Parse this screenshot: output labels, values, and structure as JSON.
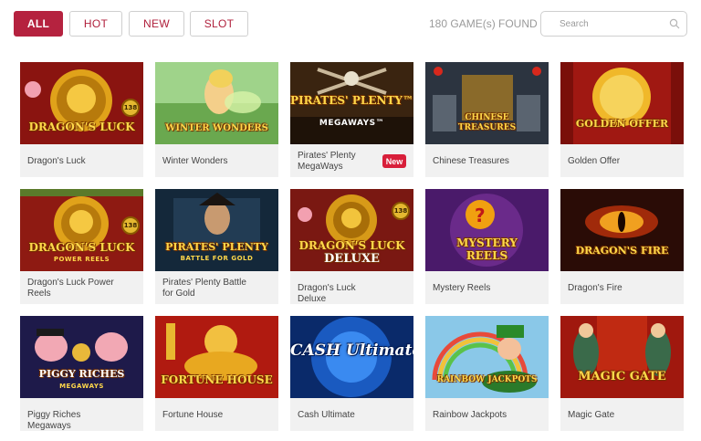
{
  "filters": {
    "all": "ALL",
    "hot": "HOT",
    "new": "NEW",
    "slot": "SLOT"
  },
  "games_found": "180 GAME(s) FOUND",
  "search": {
    "placeholder": "Search"
  },
  "colors": {
    "accent": "#b5223f",
    "badge": "#d81f3a"
  },
  "games": [
    {
      "name": "Dragon's Luck",
      "art_title": "DRAGON'S LUCK",
      "art_sub": "",
      "art_badge": "138",
      "new_label": ""
    },
    {
      "name": "Winter Wonders",
      "art_title": "WINTER WONDERS",
      "art_sub": "",
      "art_badge": "",
      "new_label": ""
    },
    {
      "name": "Pirates' Plenty MegaWays",
      "art_title": "PIRATES' PLENTY™",
      "art_sub": "MEGAWAYS™",
      "art_badge": "",
      "new_label": "New"
    },
    {
      "name": "Chinese Treasures",
      "art_title": "CHINESE TREASURES",
      "art_sub": "",
      "art_badge": "",
      "new_label": ""
    },
    {
      "name": "Golden Offer",
      "art_title": "GOLDEN OFFER",
      "art_sub": "",
      "art_badge": "",
      "new_label": ""
    },
    {
      "name": "Dragon's Luck Power Reels",
      "art_title": "DRAGON'S LUCK",
      "art_sub": "POWER REELS",
      "art_badge": "138",
      "new_label": ""
    },
    {
      "name": "Pirates' Plenty Battle for Gold",
      "art_title": "PIRATES' PLENTY",
      "art_sub": "BATTLE FOR GOLD",
      "art_badge": "",
      "new_label": ""
    },
    {
      "name": "Dragon's Luck Deluxe",
      "art_title": "DRAGON'S LUCK",
      "art_sub": "DELUXE",
      "art_badge": "138",
      "new_label": ""
    },
    {
      "name": "Mystery Reels",
      "art_title": "MYSTERY REELS",
      "art_sub": "",
      "art_badge": "",
      "new_label": ""
    },
    {
      "name": "Dragon's Fire",
      "art_title": "DRAGON'S FIRE",
      "art_sub": "",
      "art_badge": "",
      "new_label": ""
    },
    {
      "name": "Piggy Riches Megaways",
      "art_title": "PIGGY RICHES",
      "art_sub": "MEGAWAYS",
      "art_badge": "",
      "new_label": ""
    },
    {
      "name": "Fortune House",
      "art_title": "FORTUNE HOUSE",
      "art_sub": "",
      "art_badge": "",
      "new_label": ""
    },
    {
      "name": "Cash Ultimate",
      "art_title": "CASH Ultimate",
      "art_sub": "",
      "art_badge": "",
      "new_label": ""
    },
    {
      "name": "Rainbow Jackpots",
      "art_title": "RAINBOW JACKPOTS",
      "art_sub": "",
      "art_badge": "",
      "new_label": ""
    },
    {
      "name": "Magic Gate",
      "art_title": "MAGIC GATE",
      "art_sub": "",
      "art_badge": "",
      "new_label": ""
    }
  ]
}
